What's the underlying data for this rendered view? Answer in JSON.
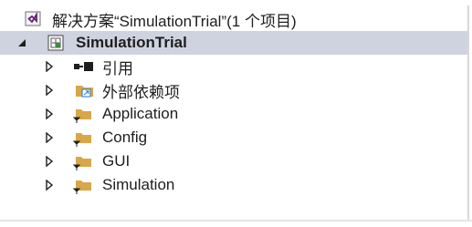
{
  "solution": {
    "label": "解决方案“SimulationTrial”(1 个项目)",
    "icon": "visual-studio-solution-icon"
  },
  "project": {
    "label": "SimulationTrial",
    "icon": "csharp-project-icon"
  },
  "items": [
    {
      "label": "引用",
      "icon": "references-icon"
    },
    {
      "label": "外部依赖项",
      "icon": "external-dependencies-folder-icon"
    },
    {
      "label": "Application",
      "icon": "filter-folder-icon"
    },
    {
      "label": "Config",
      "icon": "filter-folder-icon"
    },
    {
      "label": "GUI",
      "icon": "filter-folder-icon"
    },
    {
      "label": "Simulation",
      "icon": "filter-folder-icon"
    }
  ],
  "colors": {
    "selection": "#cfd3e0",
    "folder": "#d8a74a",
    "vs_purple": "#68217a"
  }
}
